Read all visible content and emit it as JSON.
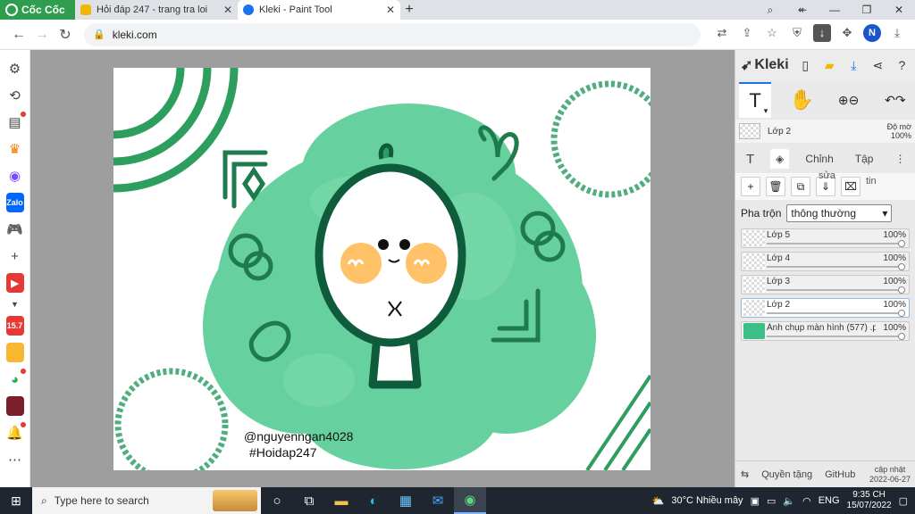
{
  "browser": {
    "brand": "Cốc Cốc",
    "tabs": [
      {
        "title": "Hỏi đáp 247 - trang tra loi",
        "active": false
      },
      {
        "title": "Kleki - Paint Tool",
        "active": true
      }
    ],
    "new_tab": "+",
    "url": "kleki.com",
    "profile_initial": "N"
  },
  "sidebar_icons": [
    "gear-icon",
    "history-icon",
    "notes-icon",
    "crown-icon",
    "messenger-icon",
    "zalo-icon",
    "gamepad-icon",
    "add-icon",
    "youtube-icon",
    "chevron-down-icon",
    "shop-icon",
    "game-icon",
    "chrome-icon",
    "game2-icon",
    "bell-icon",
    "more-icon"
  ],
  "sidebar_badges": {
    "shop": "15.7",
    "zalo": "Zalo"
  },
  "canvas": {
    "watermark_line1": "@nguyenngan4028",
    "watermark_line2": "#Hoidap247",
    "colors": {
      "green": "#2e9e5e",
      "brush_green": "#4cc98f",
      "blush": "#ffb74d"
    }
  },
  "kleki": {
    "logo": "Kleki",
    "current_layer": "Lớp 2",
    "opacity_label": "Độ mờ",
    "opacity_value": "100%",
    "tabs": [
      "Chỉnh",
      "Tập"
    ],
    "action_labels": {
      "merge": "sửa",
      "rename": "tin"
    },
    "blend_label": "Pha trộn",
    "blend_value": "thông thường",
    "layers": [
      {
        "name": "Lớp 5",
        "opacity": "100%",
        "selected": false
      },
      {
        "name": "Lớp 4",
        "opacity": "100%",
        "selected": false
      },
      {
        "name": "Lớp 3",
        "opacity": "100%",
        "selected": false
      },
      {
        "name": "Lớp 2",
        "opacity": "100%",
        "selected": true
      },
      {
        "name": "Ảnh chụp màn hình (577) .pn",
        "opacity": "100%",
        "selected": false
      }
    ],
    "footer": {
      "privacy": "Quyền tặng",
      "github": "GitHub",
      "updated_label": "cập nhật",
      "updated_date": "2022-06-27"
    }
  },
  "taskbar": {
    "search_placeholder": "Type here to search",
    "weather": "30°C  Nhiều mây",
    "lang": "ENG",
    "time": "9:35 CH",
    "date": "15/07/2022"
  }
}
